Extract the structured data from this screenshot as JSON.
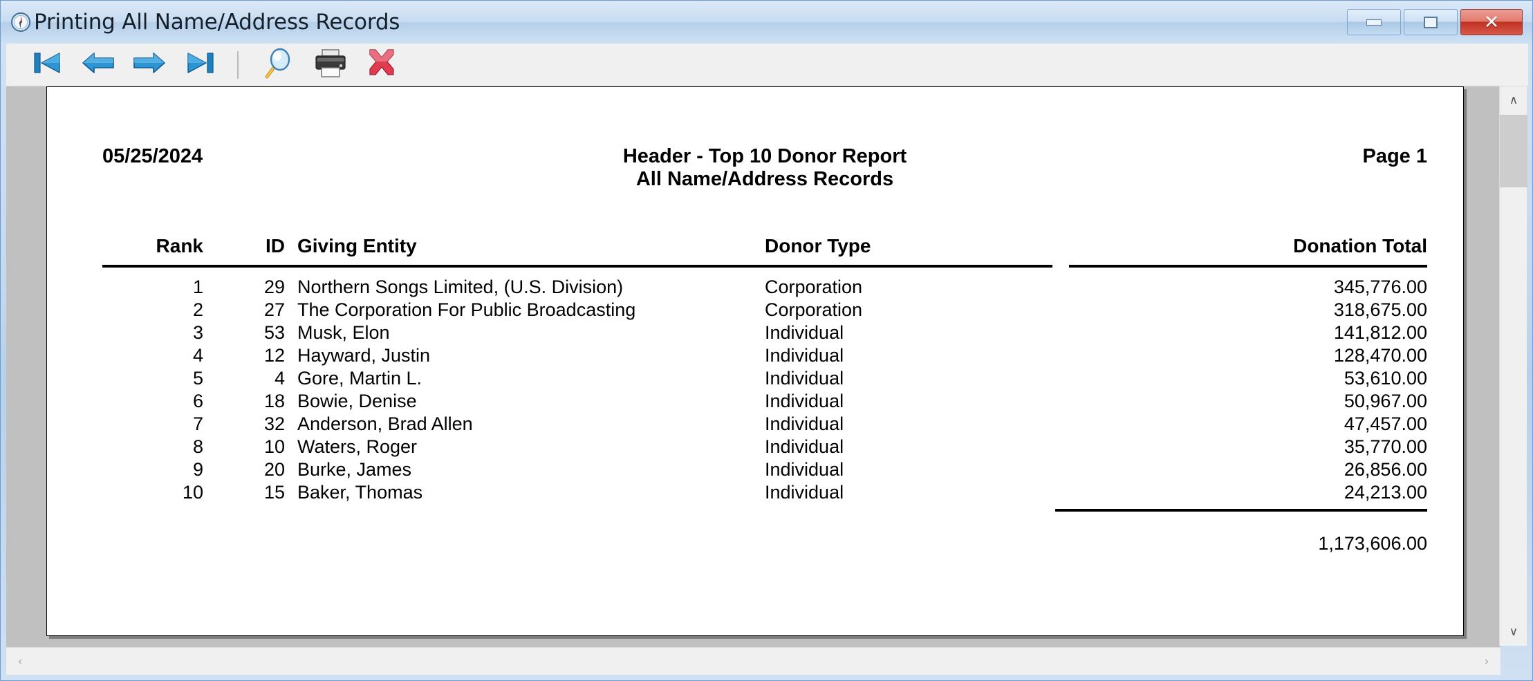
{
  "window": {
    "title": "Printing All Name/Address Records",
    "icon": "compass-icon",
    "controls": {
      "minimize": "–",
      "maximize": "□",
      "close": "✕"
    }
  },
  "toolbar": {
    "buttons": [
      {
        "name": "first-page-button",
        "icon": "first-page-icon",
        "label": "First Page"
      },
      {
        "name": "previous-page-button",
        "icon": "arrow-left-icon",
        "label": "Previous Page"
      },
      {
        "name": "next-page-button",
        "icon": "arrow-right-icon",
        "label": "Next Page"
      },
      {
        "name": "last-page-button",
        "icon": "last-page-icon",
        "label": "Last Page"
      },
      {
        "name": "zoom-button",
        "icon": "magnifier-icon",
        "label": "Zoom"
      },
      {
        "name": "print-button",
        "icon": "printer-icon",
        "label": "Print"
      },
      {
        "name": "close-button",
        "icon": "red-x-icon",
        "label": "Close"
      }
    ]
  },
  "report": {
    "date": "05/25/2024",
    "title_line1": "Header - Top 10 Donor Report",
    "title_line2": "All Name/Address Records",
    "page_label": "Page 1",
    "columns": [
      "Rank",
      "ID",
      "Giving Entity",
      "Donor Type",
      "Donation Total"
    ],
    "rows": [
      {
        "rank": "1",
        "id": "29",
        "entity": "Northern Songs Limited, (U.S. Division)",
        "type": "Corporation",
        "total": "345,776.00"
      },
      {
        "rank": "2",
        "id": "27",
        "entity": "The Corporation For Public Broadcasting",
        "type": "Corporation",
        "total": "318,675.00"
      },
      {
        "rank": "3",
        "id": "53",
        "entity": "Musk, Elon",
        "type": "Individual",
        "total": "141,812.00"
      },
      {
        "rank": "4",
        "id": "12",
        "entity": "Hayward, Justin",
        "type": "Individual",
        "total": "128,470.00"
      },
      {
        "rank": "5",
        "id": "4",
        "entity": "Gore, Martin L.",
        "type": "Individual",
        "total": "53,610.00"
      },
      {
        "rank": "6",
        "id": "18",
        "entity": "Bowie, Denise",
        "type": "Individual",
        "total": "50,967.00"
      },
      {
        "rank": "7",
        "id": "32",
        "entity": "Anderson, Brad Allen",
        "type": "Individual",
        "total": "47,457.00"
      },
      {
        "rank": "8",
        "id": "10",
        "entity": "Waters, Roger",
        "type": "Individual",
        "total": "35,770.00"
      },
      {
        "rank": "9",
        "id": "20",
        "entity": "Burke, James",
        "type": "Individual",
        "total": "26,856.00"
      },
      {
        "rank": "10",
        "id": "15",
        "entity": "Baker, Thomas",
        "type": "Individual",
        "total": "24,213.00"
      }
    ],
    "grand_total": "1,173,606.00"
  },
  "scrollbars": {
    "vertical": {
      "up": "∧",
      "down": "∨"
    },
    "horizontal": {
      "left": "‹",
      "right": "›"
    }
  },
  "colors": {
    "title_bar": "#c8dcf1",
    "toolbar_bg": "#f0f0f0",
    "page_bg": "#c0c0c0",
    "paper": "#ffffff",
    "close_red": "#bf3023",
    "arrow_blue": "#1a7fc1"
  }
}
